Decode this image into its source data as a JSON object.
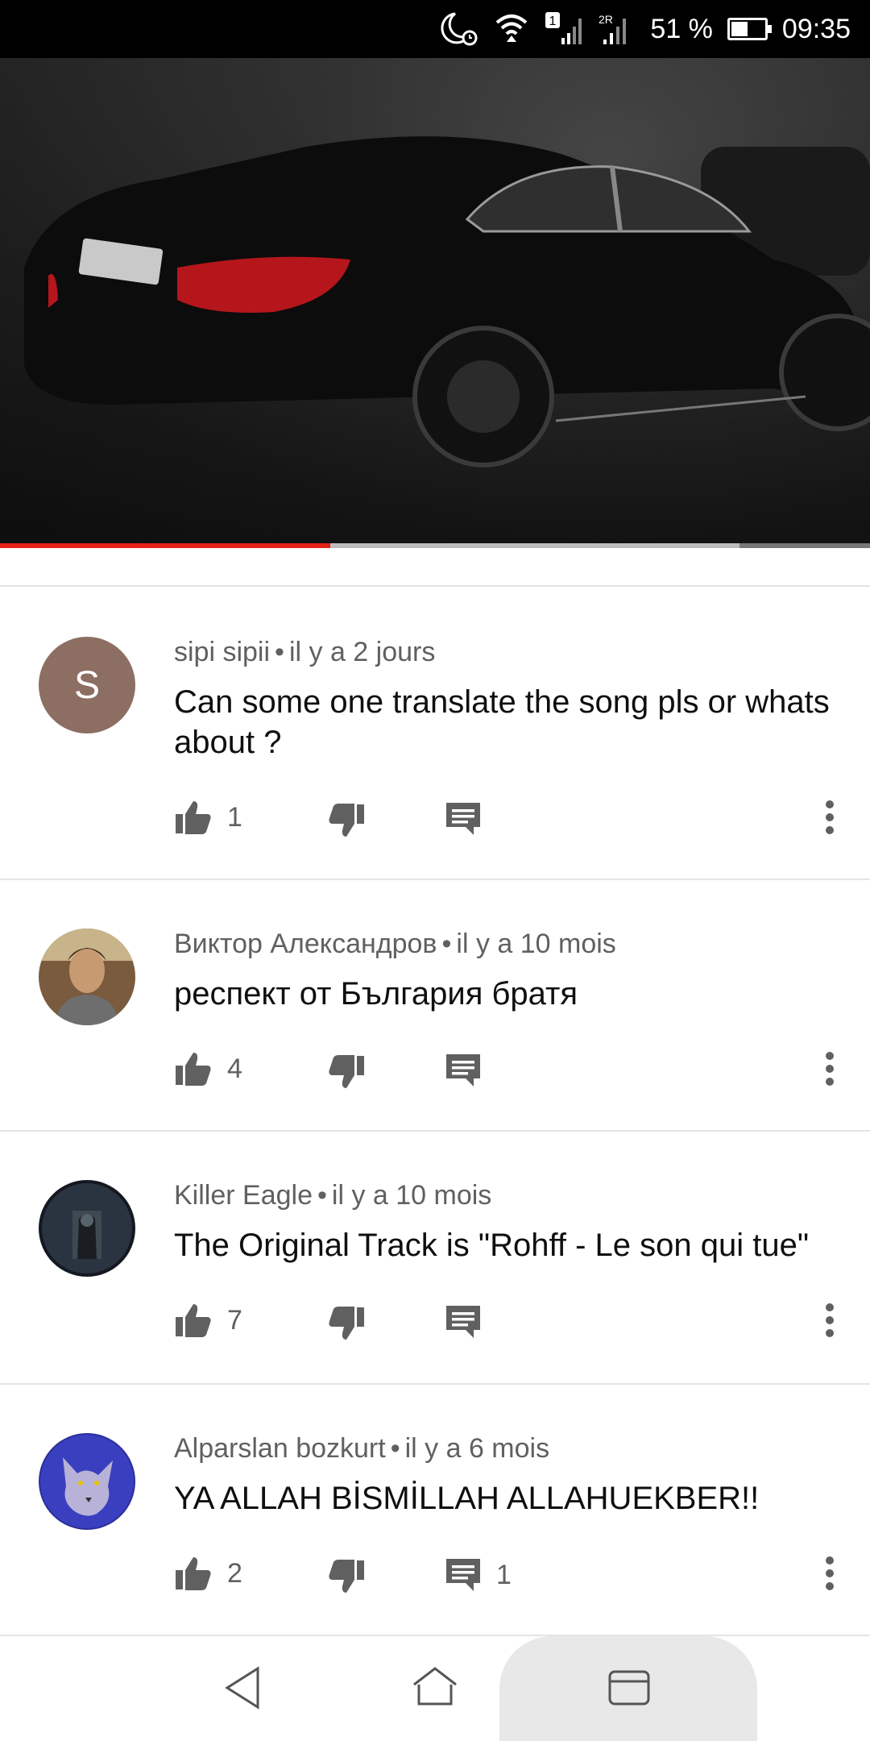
{
  "status_bar": {
    "battery_percent": "51 %",
    "time": "09:35",
    "icons": [
      "moon-alarm-icon",
      "wifi-icon",
      "signal-sim1-icon",
      "signal-sim2-icon",
      "battery-icon"
    ],
    "sim1_label": "1",
    "sim2_label": "2R"
  },
  "video": {
    "progress_played": 0.38,
    "progress_buffered": 0.85
  },
  "comments": [
    {
      "author": "sipi sipii",
      "time": "il y a 2 jours",
      "text": "Can some one translate the song pls or whats about ?",
      "likes": "1",
      "replies": "",
      "avatar_letter": "S"
    },
    {
      "author": "Виктор Александров",
      "time": "il y a 10 mois",
      "text": "респект от България братя",
      "likes": "4",
      "replies": ""
    },
    {
      "author": "Killer Eagle",
      "time": "il y a 10 mois",
      "text": "The Original Track is \"Rohff - Le son qui tue\"",
      "likes": "7",
      "replies": ""
    },
    {
      "author": "Alparslan bozkurt",
      "time": "il y a 6 mois",
      "text": "YA ALLAH BİSMİLLAH ALLAHUEKBER!!",
      "likes": "2",
      "replies": "1"
    }
  ],
  "separator": "•",
  "colors": {
    "accent_red": "#e62117",
    "text_primary": "#0f0f0f",
    "text_secondary": "#606060",
    "icon_gray": "#606060"
  }
}
